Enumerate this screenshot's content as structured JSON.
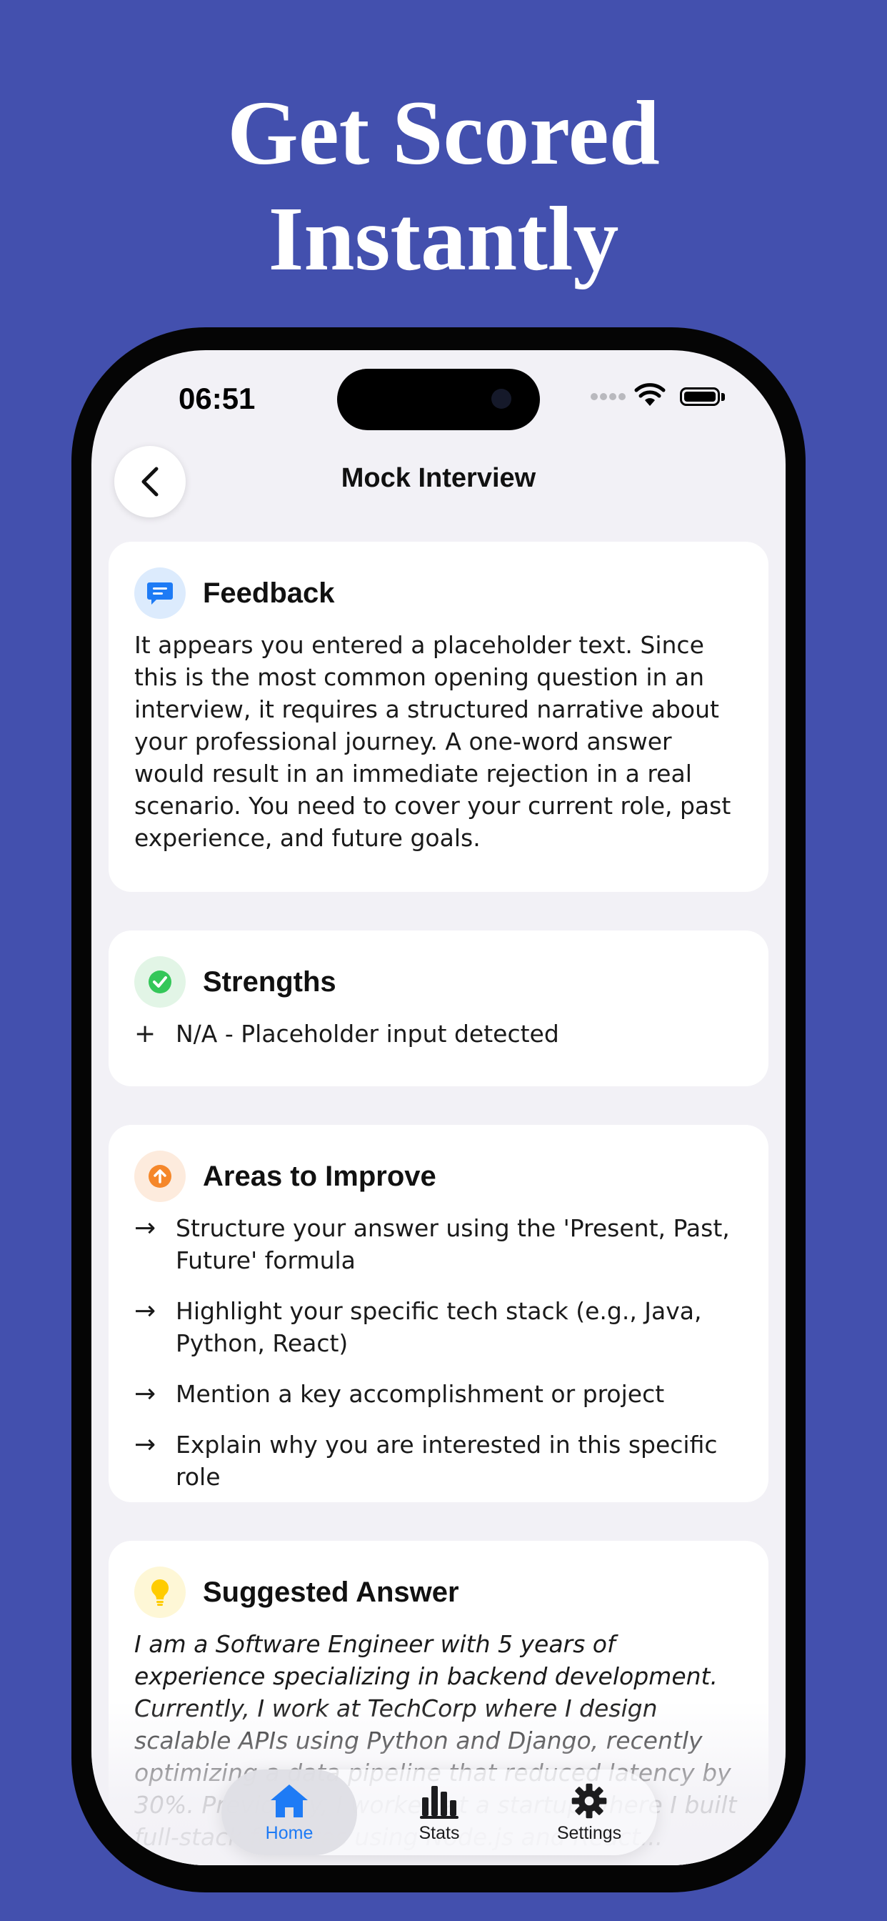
{
  "promo": {
    "headline_line1": "Get Scored",
    "headline_line2": "Instantly"
  },
  "status_bar": {
    "time": "06:51"
  },
  "nav": {
    "title": "Mock Interview"
  },
  "feedback": {
    "title": "Feedback",
    "icon": "chat-bubble-icon",
    "text": "It appears you entered a placeholder text. Since this is the most common opening question in an interview, it requires a structured narrative about your professional journey. A one-word answer would result in an immediate rejection in a real scenario. You need to cover your current role, past experience, and future goals."
  },
  "strengths": {
    "title": "Strengths",
    "icon": "checkmark-circle-icon",
    "items": [
      "N/A - Placeholder input detected"
    ]
  },
  "improve": {
    "title": "Areas to Improve",
    "icon": "arrow-up-circle-icon",
    "items": [
      "Structure your answer using the 'Present, Past, Future' formula",
      "Highlight your specific tech stack (e.g., Java, Python, React)",
      "Mention a key accomplishment or project",
      "Explain why you are interested in this specific role"
    ]
  },
  "suggested": {
    "title": "Suggested Answer",
    "icon": "lightbulb-icon",
    "text": "I am a Software Engineer with 5 years of experience specializing in backend development. Currently, I work at TechCorp where I design scalable APIs using Python and Django, recently optimizing a data pipeline that reduced latency by 30%. Previously, I worked at a startup where I built full-stack features using Node.js and React..."
  },
  "tabs": [
    {
      "label": "Home",
      "icon": "house-icon",
      "active": true
    },
    {
      "label": "Stats",
      "icon": "bar-chart-icon",
      "active": false
    },
    {
      "label": "Settings",
      "icon": "gear-icon",
      "active": false
    }
  ],
  "colors": {
    "background": "#4350AE",
    "accent": "#1E7BF5",
    "feedback_badge": "#DCEBFD",
    "strengths_badge": "#E2F5E6",
    "improve_badge": "#FDEBDD",
    "suggested_badge": "#FEF7D6"
  }
}
